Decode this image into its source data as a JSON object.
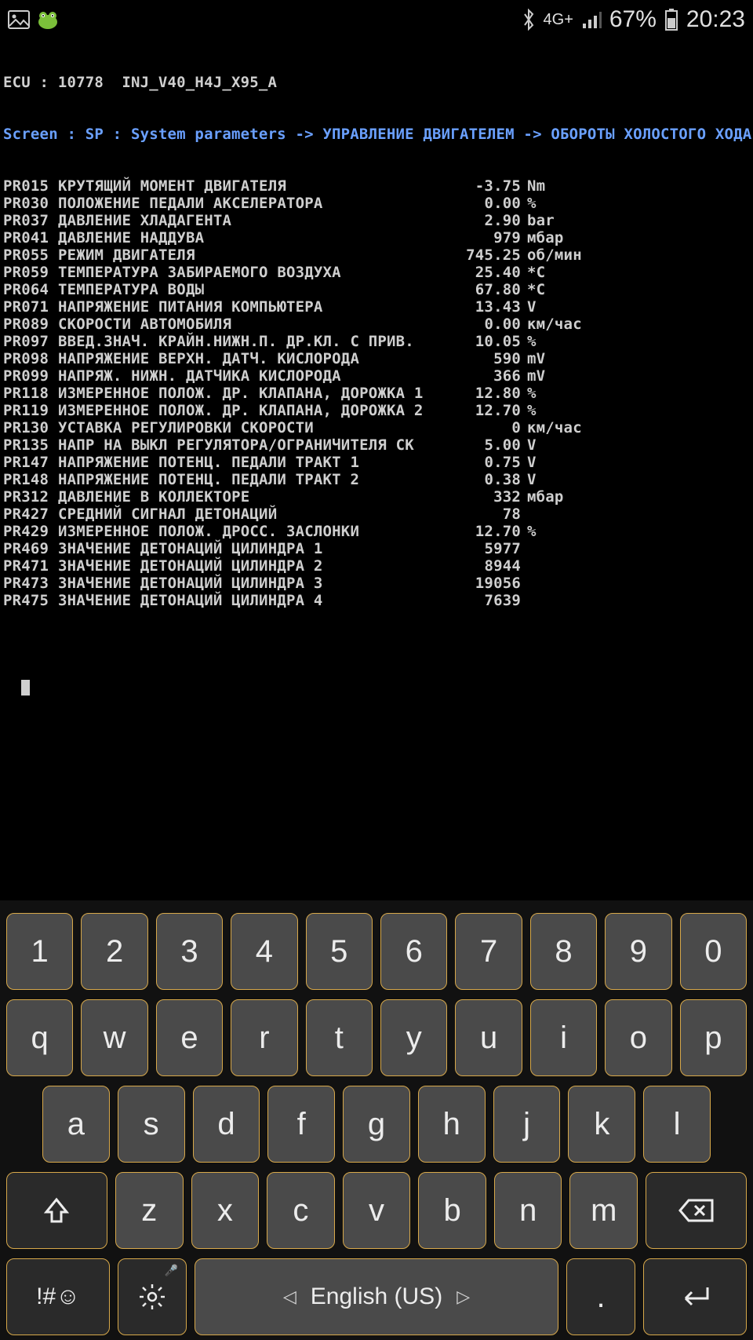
{
  "status": {
    "network": "4G+",
    "battery": "67%",
    "time": "20:23"
  },
  "terminal": {
    "header1_pre": "ECU : ",
    "header1_id": "10778",
    "header1_inj": "  INJ_V40_H4J_X95_A",
    "header2_pre": "Screen : SP : ",
    "header2_path": "System parameters -> УПРАВЛЕНИЕ ДВИГАТЕЛЕМ -> ОБОРОТЫ ХОЛОСТОГО ХОДА",
    "rows": [
      {
        "pid": "PR015",
        "desc": "КРУТЯЩИЙ МОМЕНТ ДВИГАТЕЛЯ",
        "val": "-3.75",
        "unit": "Nm"
      },
      {
        "pid": "PR030",
        "desc": "ПОЛОЖЕНИЕ ПЕДАЛИ АКСЕЛЕРАТОРА",
        "val": "0.00",
        "unit": "%"
      },
      {
        "pid": "PR037",
        "desc": "ДАВЛЕНИЕ ХЛАДАГЕНТА",
        "val": "2.90",
        "unit": "bar"
      },
      {
        "pid": "PR041",
        "desc": "ДАВЛЕНИЕ НАДДУВА",
        "val": "979",
        "unit": "мбар"
      },
      {
        "pid": "PR055",
        "desc": "РЕЖИМ ДВИГАТЕЛЯ",
        "val": "745.25",
        "unit": "об/мин"
      },
      {
        "pid": "PR059",
        "desc": "ТЕМПЕРАТУРА ЗАБИРАЕМОГО ВОЗДУХА",
        "val": "25.40",
        "unit": "*C"
      },
      {
        "pid": "PR064",
        "desc": "ТЕМПЕРАТУРА ВОДЫ",
        "val": "67.80",
        "unit": "*C"
      },
      {
        "pid": "PR071",
        "desc": "НАПРЯЖЕНИЕ ПИТАНИЯ КОМПЬЮТЕРА",
        "val": "13.43",
        "unit": "V"
      },
      {
        "pid": "PR089",
        "desc": "СКОРОСТИ АВТОМОБИЛЯ",
        "val": "0.00",
        "unit": "км/час"
      },
      {
        "pid": "PR097",
        "desc": "ВВЕД.ЗНАЧ. КРАЙН.НИЖН.П. ДР.КЛ. С ПРИВ.",
        "val": "10.05",
        "unit": "%"
      },
      {
        "pid": "PR098",
        "desc": "НАПРЯЖЕНИЕ ВЕРХН. ДАТЧ. КИСЛОРОДА",
        "val": "590",
        "unit": "mV"
      },
      {
        "pid": "PR099",
        "desc": "НАПРЯЖ. НИЖН. ДАТЧИКА КИСЛОРОДА",
        "val": "366",
        "unit": "mV"
      },
      {
        "pid": "PR118",
        "desc": "ИЗМЕРЕННОЕ ПОЛОЖ. ДР. КЛАПАНА, ДОРОЖКА 1",
        "val": "12.80",
        "unit": "%"
      },
      {
        "pid": "PR119",
        "desc": "ИЗМЕРЕННОЕ ПОЛОЖ. ДР. КЛАПАНА, ДОРОЖКА 2",
        "val": "12.70",
        "unit": "%"
      },
      {
        "pid": "PR130",
        "desc": "УСТАВКА РЕГУЛИРОВКИ СКОРОСТИ",
        "val": "0",
        "unit": "км/час"
      },
      {
        "pid": "PR135",
        "desc": "НАПР НА ВЫКЛ РЕГУЛЯТОРА/ОГРАНИЧИТЕЛЯ СК",
        "val": "5.00",
        "unit": "V"
      },
      {
        "pid": "PR147",
        "desc": "НАПРЯЖЕНИЕ ПОТЕНЦ. ПЕДАЛИ ТРАКТ 1",
        "val": "0.75",
        "unit": "V"
      },
      {
        "pid": "PR148",
        "desc": "НАПРЯЖЕНИЕ ПОТЕНЦ. ПЕДАЛИ ТРАКТ 2",
        "val": "0.38",
        "unit": "V"
      },
      {
        "pid": "PR312",
        "desc": "ДАВЛЕНИЕ В КОЛЛЕКТОРЕ",
        "val": "332",
        "unit": "мбар"
      },
      {
        "pid": "PR427",
        "desc": "СРЕДНИЙ СИГНАЛ ДЕТОНАЦИЙ",
        "val": "78",
        "unit": ""
      },
      {
        "pid": "PR429",
        "desc": "ИЗМЕРЕННОЕ ПОЛОЖ. ДРОСС. ЗАСЛОНКИ",
        "val": "12.70",
        "unit": "%"
      },
      {
        "pid": "PR469",
        "desc": "ЗНАЧЕНИЕ ДЕТОНАЦИЙ ЦИЛИНДРА 1",
        "val": "5977",
        "unit": ""
      },
      {
        "pid": "PR471",
        "desc": "ЗНАЧЕНИЕ ДЕТОНАЦИЙ ЦИЛИНДРА 2",
        "val": "8944",
        "unit": ""
      },
      {
        "pid": "PR473",
        "desc": "ЗНАЧЕНИЕ ДЕТОНАЦИЙ ЦИЛИНДРА 3",
        "val": "19056",
        "unit": ""
      },
      {
        "pid": "PR475",
        "desc": "ЗНАЧЕНИЕ ДЕТОНАЦИЙ ЦИЛИНДРА 4",
        "val": "7639",
        "unit": ""
      }
    ]
  },
  "keyboard": {
    "row1": [
      "1",
      "2",
      "3",
      "4",
      "5",
      "6",
      "7",
      "8",
      "9",
      "0"
    ],
    "row2": [
      "q",
      "w",
      "e",
      "r",
      "t",
      "y",
      "u",
      "i",
      "o",
      "p"
    ],
    "row3": [
      "a",
      "s",
      "d",
      "f",
      "g",
      "h",
      "j",
      "k",
      "l"
    ],
    "row4_letters": [
      "z",
      "x",
      "c",
      "v",
      "b",
      "n",
      "m"
    ],
    "sym": "!#☺",
    "space": "English (US)",
    "period": "."
  }
}
